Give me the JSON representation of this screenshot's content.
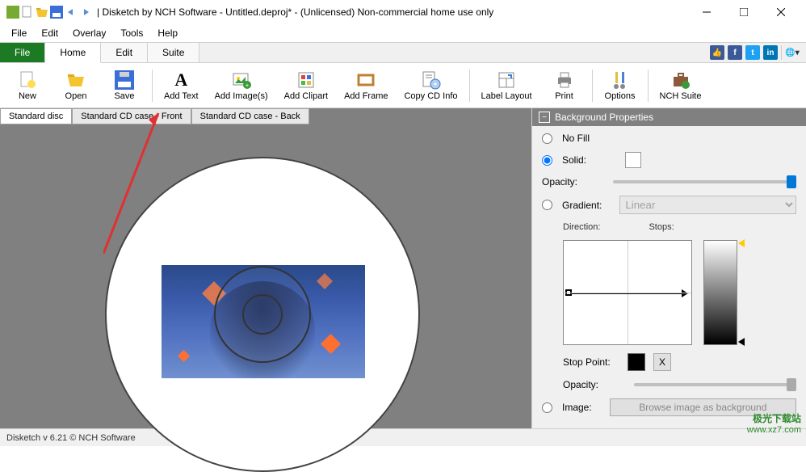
{
  "window": {
    "title": "| Disketch by NCH Software - Untitled.deproj* - (Unlicensed) Non-commercial home use only"
  },
  "menubar": {
    "items": [
      "File",
      "Edit",
      "Overlay",
      "Tools",
      "Help"
    ]
  },
  "ribbon_tabs": {
    "file": "File",
    "home": "Home",
    "edit": "Edit",
    "suite": "Suite"
  },
  "toolbar": {
    "new": "New",
    "open": "Open",
    "save": "Save",
    "add_text": "Add Text",
    "add_images": "Add Image(s)",
    "add_clipart": "Add Clipart",
    "add_frame": "Add Frame",
    "copy_cd": "Copy CD Info",
    "label_layout": "Label Layout",
    "print": "Print",
    "options": "Options",
    "nch_suite": "NCH Suite"
  },
  "doc_tabs": {
    "disc": "Standard disc",
    "front": "Standard CD case - Front",
    "back": "Standard CD case - Back"
  },
  "props": {
    "title": "Background Properties",
    "no_fill": "No Fill",
    "solid": "Solid:",
    "opacity": "Opacity:",
    "gradient": "Gradient:",
    "gradient_type": "Linear",
    "direction": "Direction:",
    "stops": "Stops:",
    "stop_point": "Stop Point:",
    "x": "X",
    "image": "Image:",
    "browse": "Browse image as background"
  },
  "status": "Disketch v 6.21 © NCH Software",
  "watermark": {
    "cn": "极光下载站",
    "url": "www.xz7.com"
  }
}
